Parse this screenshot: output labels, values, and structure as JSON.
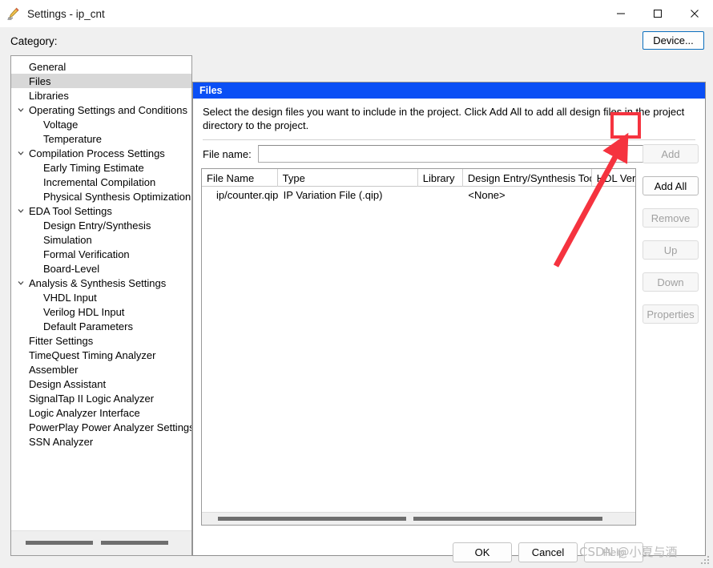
{
  "window": {
    "title": "Settings - ip_cnt",
    "icon": "pencil-settings-icon",
    "minimize": "─",
    "maximize": "☐",
    "close": "✕"
  },
  "category": {
    "label": "Category:",
    "selected": "Files",
    "items": [
      {
        "label": "General",
        "level": 0,
        "expandable": false,
        "expanded": false,
        "selected": false
      },
      {
        "label": "Files",
        "level": 0,
        "expandable": false,
        "expanded": false,
        "selected": true
      },
      {
        "label": "Libraries",
        "level": 0,
        "expandable": false,
        "expanded": false,
        "selected": false
      },
      {
        "label": "Operating Settings and Conditions",
        "level": 0,
        "expandable": true,
        "expanded": true,
        "selected": false
      },
      {
        "label": "Voltage",
        "level": 1,
        "expandable": false,
        "expanded": false,
        "selected": false
      },
      {
        "label": "Temperature",
        "level": 1,
        "expandable": false,
        "expanded": false,
        "selected": false
      },
      {
        "label": "Compilation Process Settings",
        "level": 0,
        "expandable": true,
        "expanded": true,
        "selected": false
      },
      {
        "label": "Early Timing Estimate",
        "level": 1,
        "expandable": false,
        "expanded": false,
        "selected": false
      },
      {
        "label": "Incremental Compilation",
        "level": 1,
        "expandable": false,
        "expanded": false,
        "selected": false
      },
      {
        "label": "Physical Synthesis Optimization",
        "level": 1,
        "expandable": false,
        "expanded": false,
        "selected": false
      },
      {
        "label": "EDA Tool Settings",
        "level": 0,
        "expandable": true,
        "expanded": true,
        "selected": false
      },
      {
        "label": "Design Entry/Synthesis",
        "level": 1,
        "expandable": false,
        "expanded": false,
        "selected": false
      },
      {
        "label": "Simulation",
        "level": 1,
        "expandable": false,
        "expanded": false,
        "selected": false
      },
      {
        "label": "Formal Verification",
        "level": 1,
        "expandable": false,
        "expanded": false,
        "selected": false
      },
      {
        "label": "Board-Level",
        "level": 1,
        "expandable": false,
        "expanded": false,
        "selected": false
      },
      {
        "label": "Analysis & Synthesis Settings",
        "level": 0,
        "expandable": true,
        "expanded": true,
        "selected": false
      },
      {
        "label": "VHDL Input",
        "level": 1,
        "expandable": false,
        "expanded": false,
        "selected": false
      },
      {
        "label": "Verilog HDL Input",
        "level": 1,
        "expandable": false,
        "expanded": false,
        "selected": false
      },
      {
        "label": "Default Parameters",
        "level": 1,
        "expandable": false,
        "expanded": false,
        "selected": false
      },
      {
        "label": "Fitter Settings",
        "level": 0,
        "expandable": false,
        "expanded": false,
        "selected": false
      },
      {
        "label": "TimeQuest Timing Analyzer",
        "level": 0,
        "expandable": false,
        "expanded": false,
        "selected": false
      },
      {
        "label": "Assembler",
        "level": 0,
        "expandable": false,
        "expanded": false,
        "selected": false
      },
      {
        "label": "Design Assistant",
        "level": 0,
        "expandable": false,
        "expanded": false,
        "selected": false
      },
      {
        "label": "SignalTap II Logic Analyzer",
        "level": 0,
        "expandable": false,
        "expanded": false,
        "selected": false
      },
      {
        "label": "Logic Analyzer Interface",
        "level": 0,
        "expandable": false,
        "expanded": false,
        "selected": false
      },
      {
        "label": "PowerPlay Power Analyzer Settings",
        "level": 0,
        "expandable": false,
        "expanded": false,
        "selected": false
      },
      {
        "label": "SSN Analyzer",
        "level": 0,
        "expandable": false,
        "expanded": false,
        "selected": false
      }
    ]
  },
  "device_button": {
    "label": "Device..."
  },
  "files_panel": {
    "title": "Files",
    "description": "Select the design files you want to include in the project. Click Add All to add all design files in the project directory to the project.",
    "filename": {
      "label": "File name:",
      "value": "",
      "placeholder": ""
    },
    "browse_button": {
      "label": "...",
      "icon": "ellipsis-icon"
    },
    "table": {
      "columns": [
        "File Name",
        "Type",
        "Library",
        "Design Entry/Synthesis Tool",
        "HDL Version"
      ],
      "rows": [
        {
          "file_name": "ip/counter.qip",
          "type": "IP Variation File (.qip)",
          "library": "",
          "tool": "<None>",
          "hdl_version": ""
        }
      ]
    },
    "actions": [
      {
        "label": "Add",
        "enabled": false
      },
      {
        "label": "Add All",
        "enabled": true
      },
      {
        "label": "Remove",
        "enabled": false
      },
      {
        "label": "Up",
        "enabled": false
      },
      {
        "label": "Down",
        "enabled": false
      },
      {
        "label": "Properties",
        "enabled": false
      }
    ]
  },
  "dialog_buttons": {
    "ok": "OK",
    "cancel": "Cancel",
    "help": "Help"
  },
  "annotation": {
    "highlight_color": "#f5333f",
    "arrow_color": "#f5333f",
    "target": "browse-button"
  },
  "watermark": {
    "text": "CSDN @小夏与酒"
  }
}
